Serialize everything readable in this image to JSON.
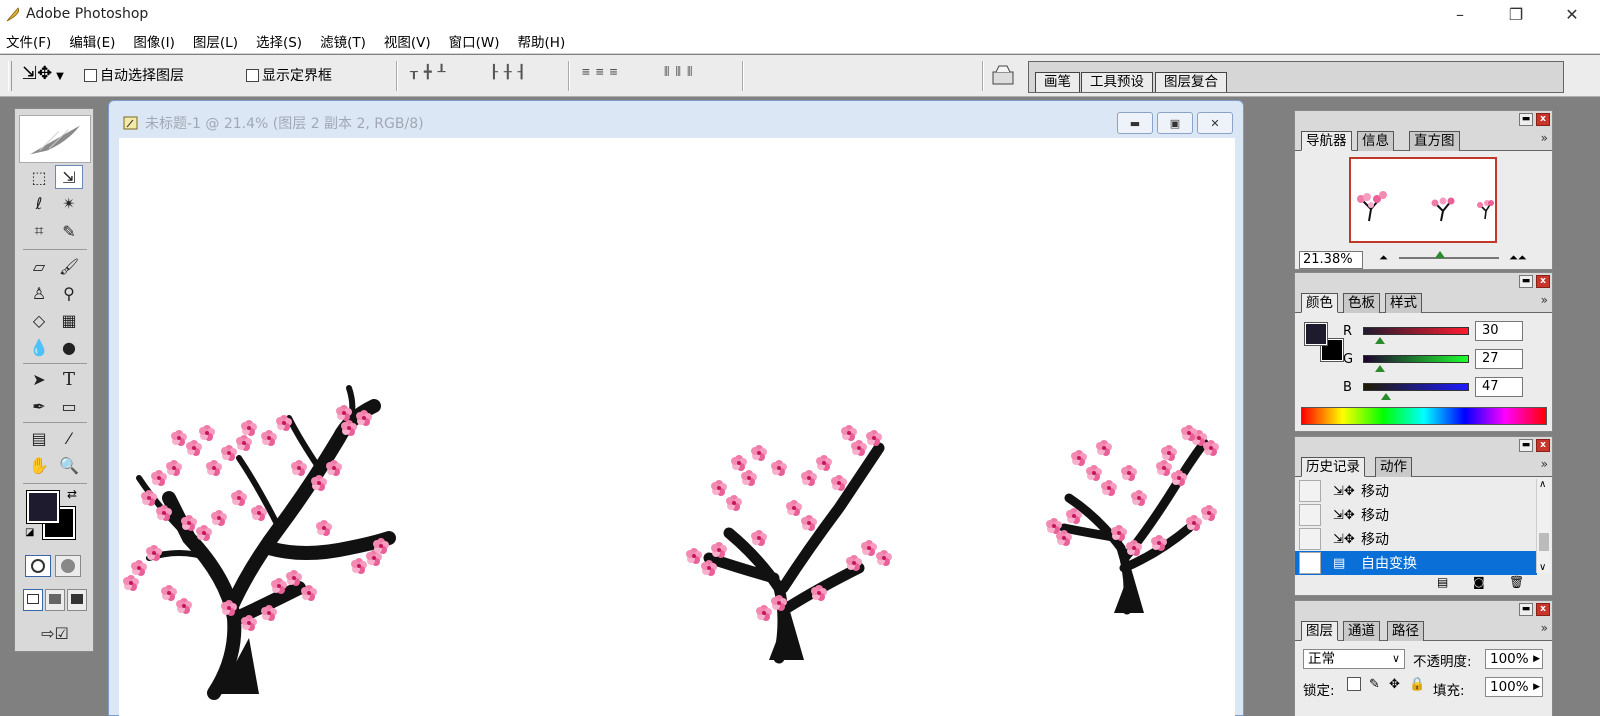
{
  "window": {
    "title": "Adobe Photoshop",
    "minimize": "–",
    "restore": "❐",
    "close": "✕"
  },
  "menu": [
    "文件(F)",
    "编辑(E)",
    "图像(I)",
    "图层(L)",
    "选择(S)",
    "滤镜(T)",
    "视图(V)",
    "窗口(W)",
    "帮助(H)"
  ],
  "options": {
    "auto_select_layer": "自动选择图层",
    "show_bounding_box": "显示定界框",
    "palette_well_tabs": [
      "画笔",
      "工具预设",
      "图层复合"
    ]
  },
  "document": {
    "title": "未标题-1 @ 21.4% (图层 2 副本 2, RGB/8)"
  },
  "navigator": {
    "tabs": [
      "导航器",
      "信息",
      "直方图"
    ],
    "zoom": "21.38%"
  },
  "color": {
    "tabs": [
      "颜色",
      "色板",
      "样式"
    ],
    "r_label": "R",
    "g_label": "G",
    "b_label": "B",
    "r": "30",
    "g": "27",
    "b": "47",
    "foreground": "#1e1b2f",
    "background": "#000000"
  },
  "history": {
    "tabs": [
      "历史记录",
      "动作"
    ],
    "items": [
      {
        "label": "移动"
      },
      {
        "label": "移动"
      },
      {
        "label": "移动"
      },
      {
        "label": "自由变换"
      }
    ],
    "selected_index": 3
  },
  "layers": {
    "tabs": [
      "图层",
      "通道",
      "路径"
    ],
    "blend_mode": "正常",
    "opacity_label": "不透明度:",
    "opacity": "100%",
    "lock_label": "锁定:",
    "fill_label": "填充:",
    "fill": "100%"
  },
  "colors": {
    "accent": "#0a6fd6",
    "close_red": "#c8352b",
    "blossom": "#e8649a"
  }
}
